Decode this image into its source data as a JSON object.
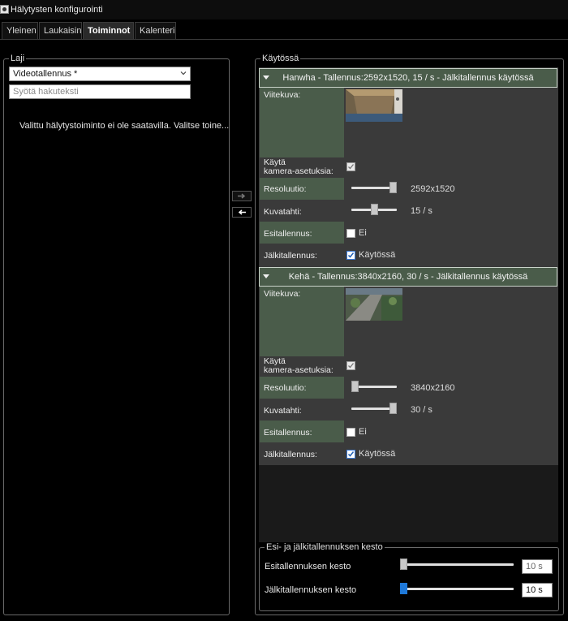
{
  "window": {
    "title": "Hälytysten konfigurointi",
    "icon": "gear-window-icon"
  },
  "tabs": [
    {
      "label": "Yleinen"
    },
    {
      "label": "Laukaisin"
    },
    {
      "label": "Toiminnot",
      "active": true
    },
    {
      "label": "Kalenteri"
    }
  ],
  "left": {
    "legend": "Laji",
    "type_value": "Videotallennus *",
    "search_placeholder": "Syötä hakuteksti",
    "message": "Valittu hälytystoiminto ei ole saatavilla. Valitse toine..."
  },
  "right": {
    "legend": "Käytössä",
    "cameras": [
      {
        "header": "Hanwha - Tallennus:2592x1520, 15 / s - Jälkitallennus käytössä",
        "thumbnail_label": "Viitekuva:",
        "use_cam_label_1": "Käytä",
        "use_cam_label_2": "kamera-asetuksia:",
        "use_cam_checked": true,
        "resolution_label": "Resoluutio:",
        "resolution_value": "2592x1520",
        "resolution_level": 1.0,
        "fps_label": "Kuvatahti:",
        "fps_value": "15 / s",
        "fps_level": 0.5,
        "pre_label": "Esitallennus:",
        "pre_value": "Ei",
        "pre_checked": false,
        "post_label": "Jälkitallennus:",
        "post_value": "Käytössä",
        "post_checked": true
      },
      {
        "header": "Kehä - Tallennus:3840x2160, 30 / s - Jälkitallennus käytössä",
        "thumbnail_label": "Viitekuva:",
        "use_cam_label_1": "Käytä",
        "use_cam_label_2": "kamera-asetuksia:",
        "use_cam_checked": true,
        "resolution_label": "Resoluutio:",
        "resolution_value": "3840x2160",
        "resolution_level": 0.0,
        "fps_label": "Kuvatahti:",
        "fps_value": "30 / s",
        "fps_level": 1.0,
        "pre_label": "Esitallennus:",
        "pre_value": "Ei",
        "pre_checked": false,
        "post_label": "Jälkitallennus:",
        "post_value": "Käytössä",
        "post_checked": true
      }
    ]
  },
  "durations": {
    "legend": "Esi- ja jälkitallennuksen kesto",
    "pre_label": "Esitallennuksen kesto",
    "pre_value": "10 s",
    "pre_level": 0.0,
    "post_label": "Jälkitallennuksen kesto",
    "post_value": "10 s",
    "post_level": 0.0
  },
  "colors": {
    "row_label_bg": "#4a5c4a",
    "accent": "#1e78d8"
  }
}
